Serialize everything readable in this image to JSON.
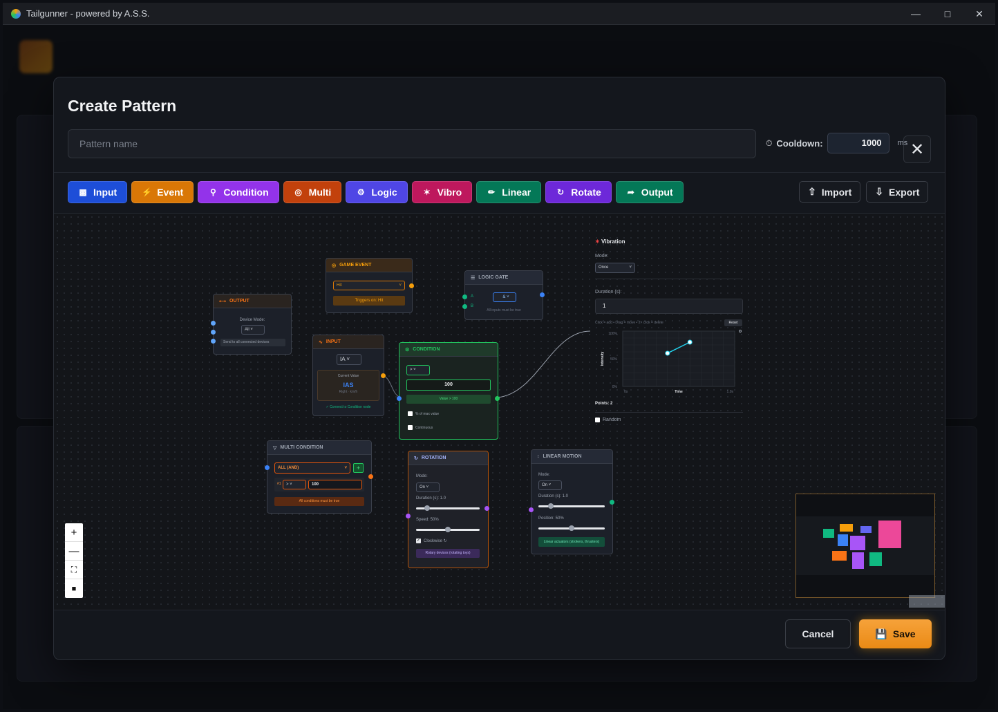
{
  "window": {
    "title": "Tailgunner - powered by A.S.S."
  },
  "modal": {
    "title": "Create Pattern",
    "name_placeholder": "Pattern name",
    "cooldown_label": "Cooldown:",
    "cooldown_value": "1000",
    "cooldown_unit": "ms"
  },
  "toolbar": {
    "buttons": [
      {
        "label": "Input",
        "color": "#2563eb"
      },
      {
        "label": "Event",
        "color": "#ea8a15"
      },
      {
        "label": "Condition",
        "color": "#9333ea"
      },
      {
        "label": "Multi",
        "color": "#c2410c"
      },
      {
        "label": "Logic",
        "color": "#4f46e5"
      },
      {
        "label": "Vibro",
        "color": "#db2777"
      },
      {
        "label": "Linear",
        "color": "#059669"
      },
      {
        "label": "Rotate",
        "color": "#7c3aed"
      },
      {
        "label": "Output",
        "color": "#059669"
      }
    ],
    "import_label": "Import",
    "export_label": "Export"
  },
  "nodes": {
    "output": {
      "title": "OUTPUT",
      "device_mode_label": "Device Mode:",
      "device_mode_value": "All",
      "note": "Send to all connected devices"
    },
    "game_event": {
      "title": "GAME EVENT",
      "select_value": "Hit",
      "note": "Triggers on: Hit"
    },
    "logic_gate": {
      "title": "LOGIC GATE",
      "port_a": "A",
      "port_b": "B",
      "select_value": "&",
      "note": "All inputs must be true"
    },
    "input": {
      "title": "INPUT",
      "select_value": "IA",
      "current_label": "Current Value",
      "current_value": "IAS",
      "sub_value": "Right ∙ km/h",
      "note": "✓ Connect to Condition node"
    },
    "condition": {
      "title": "CONDITION",
      "operator": ">",
      "threshold": "100",
      "expression": "Value > 100",
      "opt_percent": "% of max value",
      "opt_continuous": "Continuous"
    },
    "multi": {
      "title": "MULTI CONDITION",
      "mode": "ALL (AND)",
      "add": "+",
      "row_index": "#1",
      "row_op": ">",
      "row_value": "100",
      "note": "All conditions must be true"
    },
    "rotation": {
      "title": "ROTATION",
      "mode_label": "Mode:",
      "mode_value": "On",
      "duration_label": "Duration (s): 1.0",
      "speed_label": "Speed: 50%",
      "clockwise": "Clockwise ↻",
      "note": "Rotary devices (rotating toys)"
    },
    "linear": {
      "title": "LINEAR MOTION",
      "mode_label": "Mode:",
      "mode_value": "On",
      "duration_label": "Duration (s): 1.0",
      "position_label": "Position: 50%",
      "note": "Linear actuators (strokers, thrusters)"
    }
  },
  "vibration": {
    "title": "Vibration",
    "mode_label": "Mode:",
    "mode_value": "Once",
    "duration_label": "Duration (s):",
    "duration_value": "1",
    "hint": "Click = add • Drag = move • 2× click = delete",
    "reset": "Reset",
    "y_label": "Intensity",
    "y_top": "100%",
    "y_mid": "50%",
    "y_bot": "0%",
    "x_left": "0s",
    "x_label": "Time",
    "x_right": "1.0s",
    "points_label": "Points: 2",
    "random_label": "Random",
    "curve_points": [
      {
        "t": 0.4,
        "v": 0.6
      },
      {
        "t": 0.6,
        "v": 0.8
      }
    ]
  },
  "footer": {
    "cancel": "Cancel",
    "save": "Save"
  }
}
